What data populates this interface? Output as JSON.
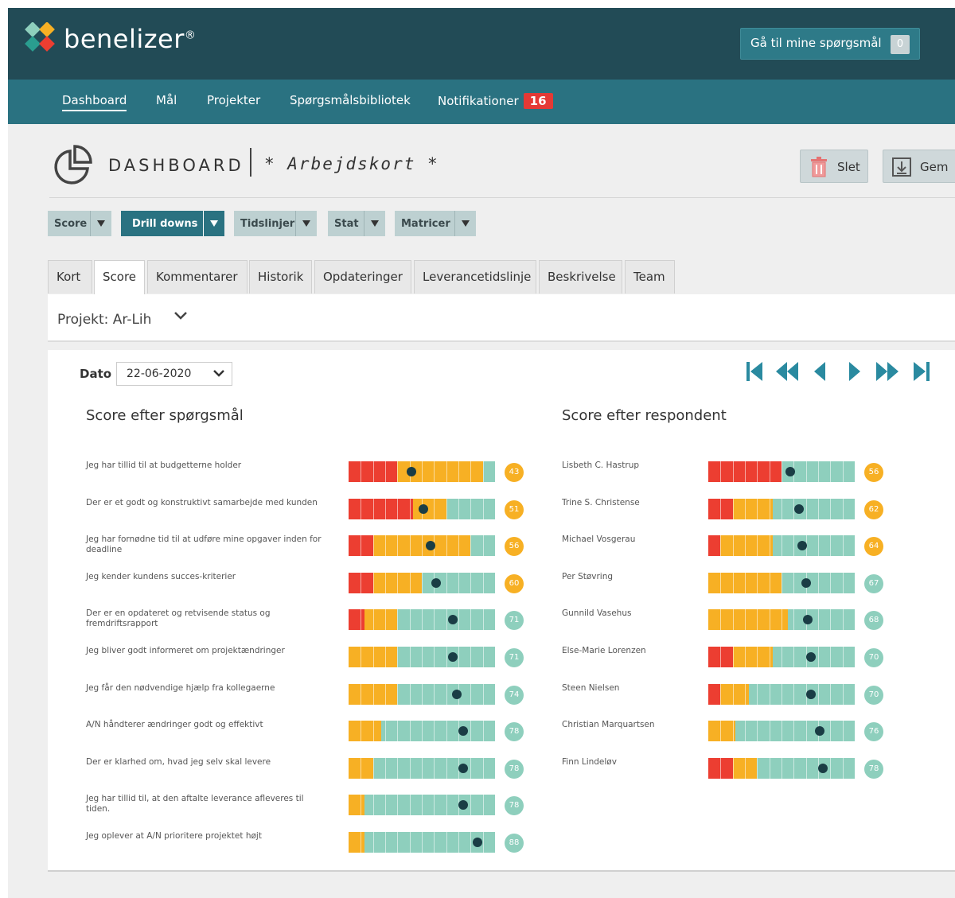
{
  "header": {
    "brand": "benelizer",
    "brand_mark": "®",
    "goto_button": "Gå til mine spørgsmål",
    "goto_count": "0"
  },
  "nav": {
    "items": [
      "Dashboard",
      "Mål",
      "Projekter",
      "Spørgsmålsbibliotek",
      "Notifikationer"
    ],
    "notification_count": "16"
  },
  "page": {
    "title": "DASHBOARD",
    "subtitle": "* Arbejdskort *",
    "delete_label": "Slet",
    "save_label": "Gem"
  },
  "dropdowns": [
    {
      "label": "Score"
    },
    {
      "label": "Drill downs"
    },
    {
      "label": "Tidslinjer"
    },
    {
      "label": "Stat"
    },
    {
      "label": "Matricer"
    }
  ],
  "tabs": [
    "Kort",
    "Score",
    "Kommentarer",
    "Historik",
    "Opdateringer",
    "Leverancetidslinje",
    "Beskrivelse",
    "Team"
  ],
  "active_tab": "Score",
  "project": {
    "label": "Projekt: Ar-Lih"
  },
  "date": {
    "label": "Dato",
    "value": "22-06-2020"
  },
  "colors": {
    "red": "#ec3e31",
    "orange": "#f7b024",
    "teal": "#8ecfbd",
    "dot": "#1a3d45",
    "header": "#224b56",
    "nav": "#2a7281"
  },
  "chart_data": [
    {
      "type": "bar",
      "title": "Score efter spørgsmål",
      "scale_cells": 12,
      "categories": [
        "Jeg har tillid til at budgetterne holder",
        "Der er et godt og konstruktivt samarbejde med kunden",
        "Jeg har fornødne tid til at udføre mine opgaver inden for deadline",
        "Jeg kender kundens succes-kriterier",
        "Der er en opdateret og retvisende status og fremdriftsrapport",
        "Jeg bliver godt informeret om projektændringer",
        "Jeg får den nødvendige hjælp fra kollegaerne",
        "A/N håndterer ændringer godt og effektivt",
        "Der er klarhed om, hvad jeg selv skal levere",
        "Jeg har tillid til, at den aftalte leverance afleveres til tiden.",
        "Jeg oplever at A/N prioritere projektet højt"
      ],
      "distribution": [
        {
          "red": 4,
          "orange": 7,
          "teal": 1
        },
        {
          "red": 5.3,
          "orange": 2.7,
          "teal": 4
        },
        {
          "red": 2,
          "orange": 8,
          "teal": 2
        },
        {
          "red": 2,
          "orange": 4,
          "teal": 6
        },
        {
          "red": 1.3,
          "orange": 2.7,
          "teal": 8
        },
        {
          "red": 0,
          "orange": 4,
          "teal": 8
        },
        {
          "red": 0,
          "orange": 4,
          "teal": 8
        },
        {
          "red": 0,
          "orange": 2.7,
          "teal": 9.3
        },
        {
          "red": 0,
          "orange": 2,
          "teal": 10
        },
        {
          "red": 0,
          "orange": 1.3,
          "teal": 10.7
        },
        {
          "red": 0,
          "orange": 1.3,
          "teal": 10.7
        }
      ],
      "dot_position": [
        0.43,
        0.51,
        0.56,
        0.6,
        0.71,
        0.71,
        0.74,
        0.78,
        0.78,
        0.78,
        0.88
      ],
      "values": [
        43,
        51,
        56,
        60,
        71,
        71,
        74,
        78,
        78,
        78,
        88
      ]
    },
    {
      "type": "bar",
      "title": "Score efter respondent",
      "scale_cells": 12,
      "categories": [
        "Lisbeth C. Hastrup",
        "Trine S. Christense",
        "Michael Vosgerau",
        "Per Støvring",
        "Gunnild Vasehus",
        "Else-Marie Lorenzen",
        "Steen Nielsen",
        "Christian Marquartsen",
        "Finn Lindeløv"
      ],
      "distribution": [
        {
          "red": 6,
          "orange": 0,
          "teal": 6
        },
        {
          "red": 2,
          "orange": 3.3,
          "teal": 6.7
        },
        {
          "red": 1,
          "orange": 4.3,
          "teal": 6.7
        },
        {
          "red": 0,
          "orange": 6,
          "teal": 6
        },
        {
          "red": 0,
          "orange": 6.5,
          "teal": 5.5
        },
        {
          "red": 2,
          "orange": 3.3,
          "teal": 6.7
        },
        {
          "red": 1,
          "orange": 2.3,
          "teal": 8.7
        },
        {
          "red": 0,
          "orange": 2.2,
          "teal": 9.8
        },
        {
          "red": 2,
          "orange": 2,
          "teal": 8
        }
      ],
      "dot_position": [
        0.56,
        0.62,
        0.64,
        0.67,
        0.68,
        0.7,
        0.7,
        0.76,
        0.78
      ],
      "values": [
        56,
        62,
        64,
        67,
        68,
        70,
        70,
        76,
        78
      ]
    }
  ]
}
